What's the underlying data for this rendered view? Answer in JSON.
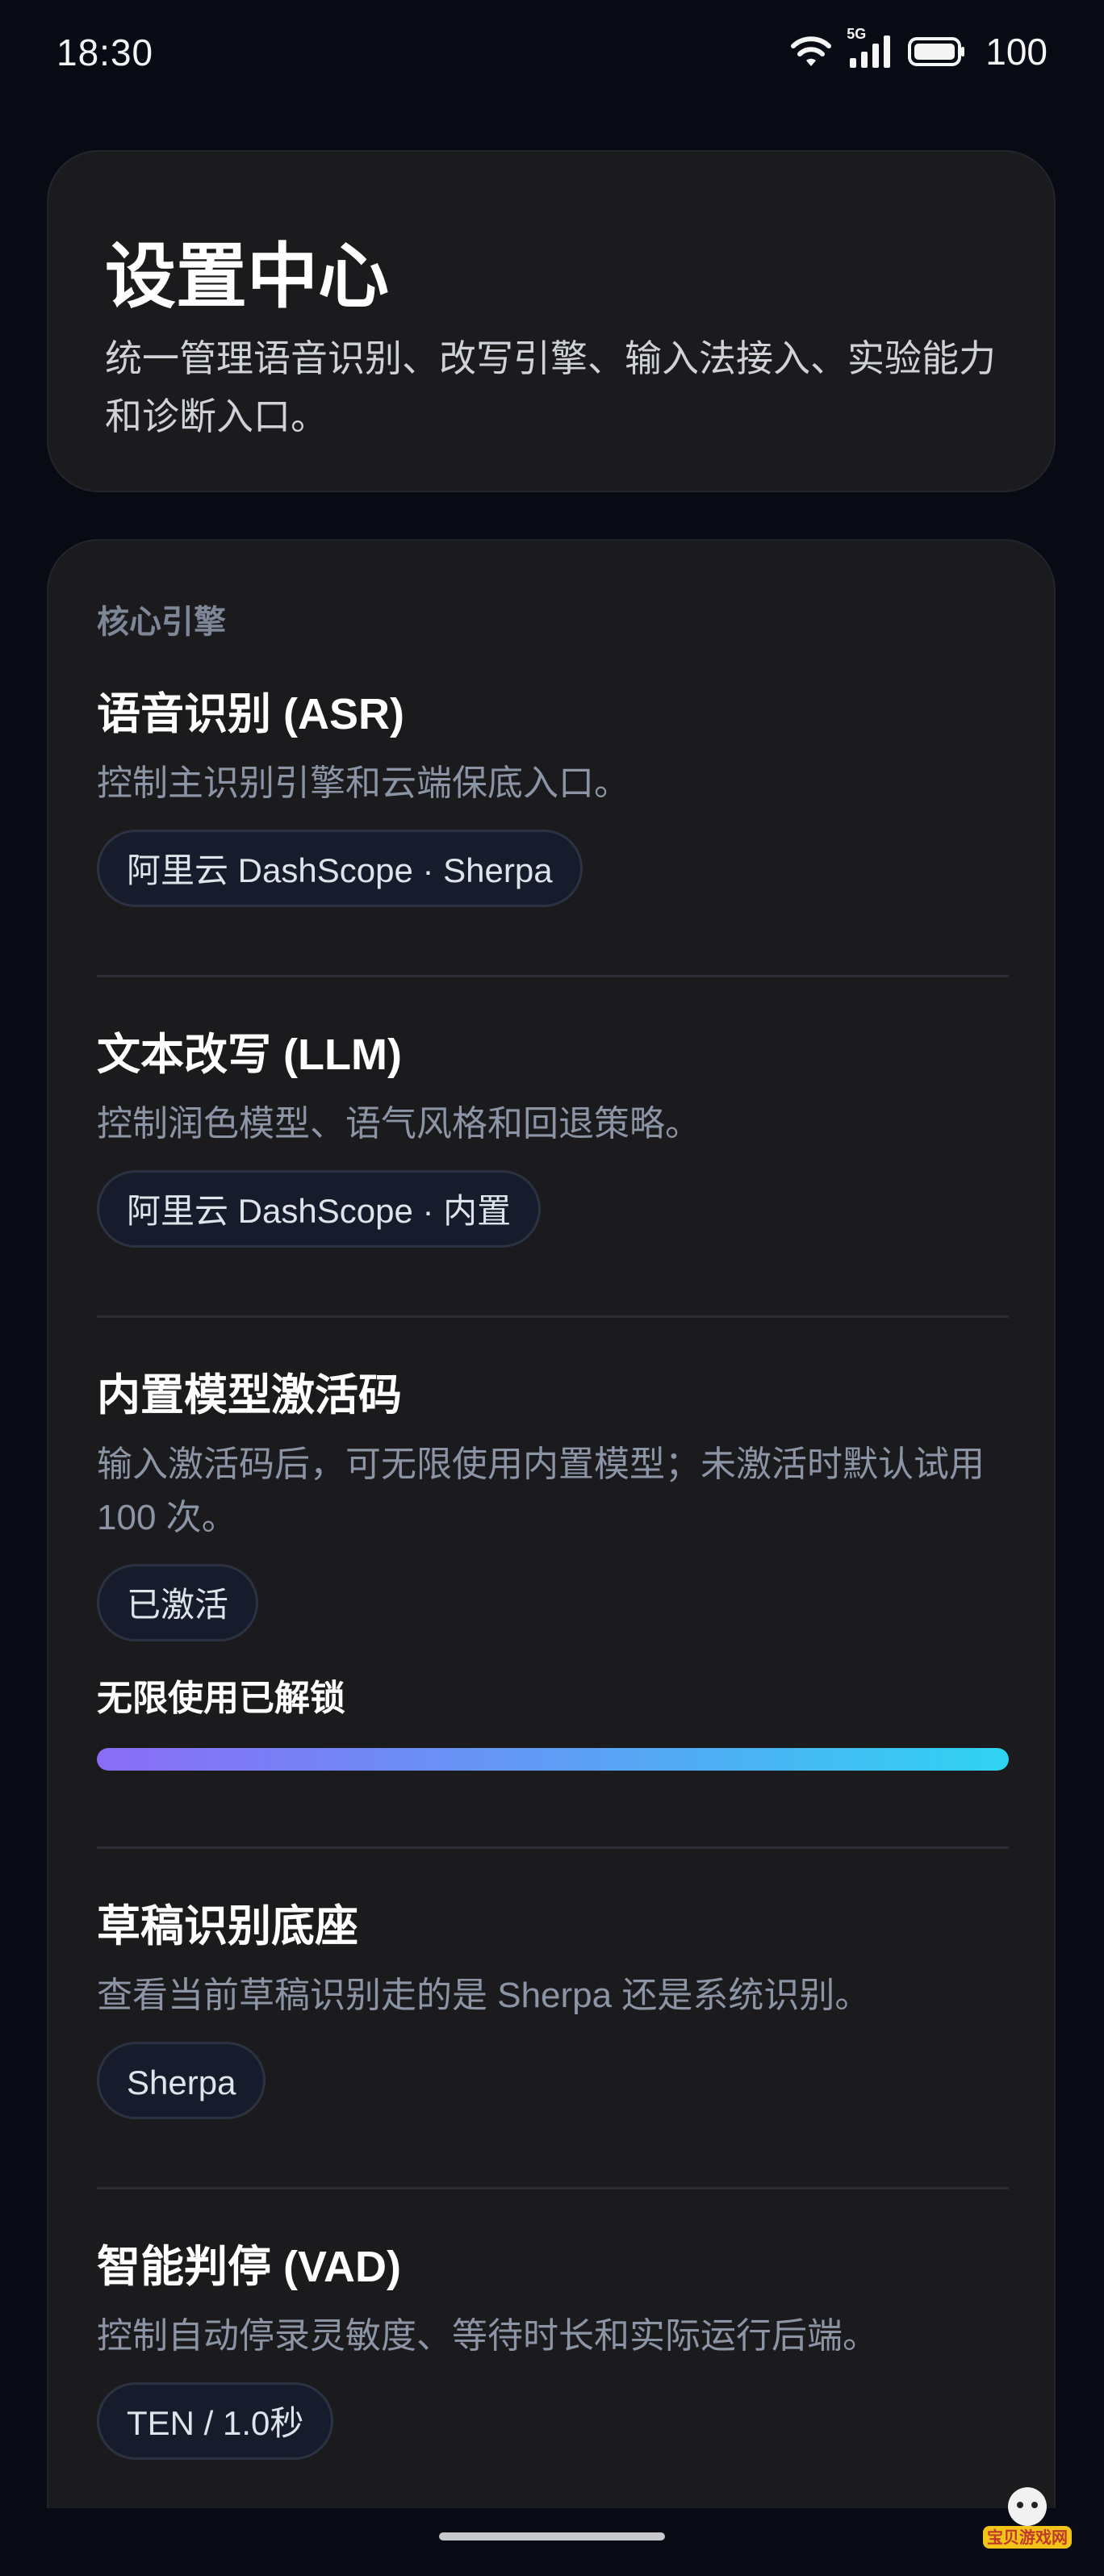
{
  "status_bar": {
    "time": "18:30",
    "network_label": "5G",
    "battery": "100",
    "icons": [
      "wifi-icon",
      "cellular-signal-icon",
      "battery-icon"
    ]
  },
  "hero": {
    "title": "设置中心",
    "description": "统一管理语音识别、改写引擎、输入法接入、实验能力和诊断入口。"
  },
  "engine_section": {
    "label": "核心引擎",
    "settings": [
      {
        "title": "语音识别 (ASR)",
        "description": "控制主识别引擎和云端保底入口。",
        "chip": "阿里云 DashScope · Sherpa"
      },
      {
        "title": "文本改写 (LLM)",
        "description": "控制润色模型、语气风格和回退策略。",
        "chip": "阿里云 DashScope · 内置"
      },
      {
        "title": "内置模型激活码",
        "description": "输入激活码后，可无限使用内置模型；未激活时默认试用 100 次。",
        "chip": "已激活",
        "status_text": "无限使用已解锁",
        "progress": 1.0
      },
      {
        "title": "草稿识别底座",
        "description": "查看当前草稿识别走的是 Sherpa 还是系统识别。",
        "chip": "Sherpa"
      },
      {
        "title": "智能判停 (VAD)",
        "description": "控制自动停录灵敏度、等待时长和实际运行后端。",
        "chip": "TEN / 1.0秒"
      }
    ]
  },
  "watermark": {
    "text": "宝贝游戏网"
  },
  "colors": {
    "background": "#080b14",
    "card": "#1b1b1d",
    "chip_bg": "#161c2b",
    "progress_start": "#8b6cf6",
    "progress_end": "#2fd3f2"
  }
}
